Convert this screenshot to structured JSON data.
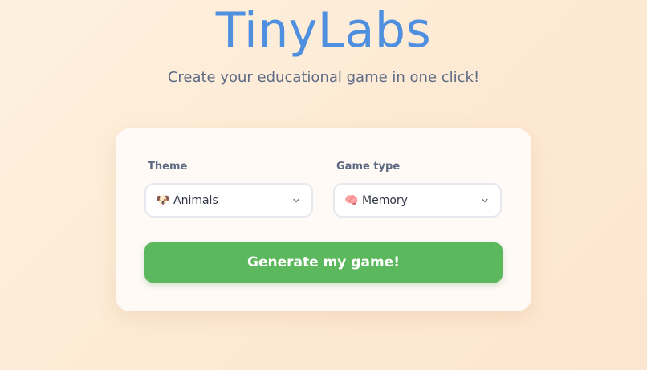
{
  "header": {
    "title": "TinyLabs",
    "tagline": "Create your educational game in one click!"
  },
  "form": {
    "theme": {
      "label": "Theme",
      "selected": "Animals",
      "icon": "🐶"
    },
    "game_type": {
      "label": "Game type",
      "selected": "Memory",
      "icon": "🧠"
    },
    "generate_label": "Generate my game!"
  },
  "colors": {
    "brand": "#4f8fe0",
    "button": "#5cb85c",
    "background": "#fdeedd"
  }
}
